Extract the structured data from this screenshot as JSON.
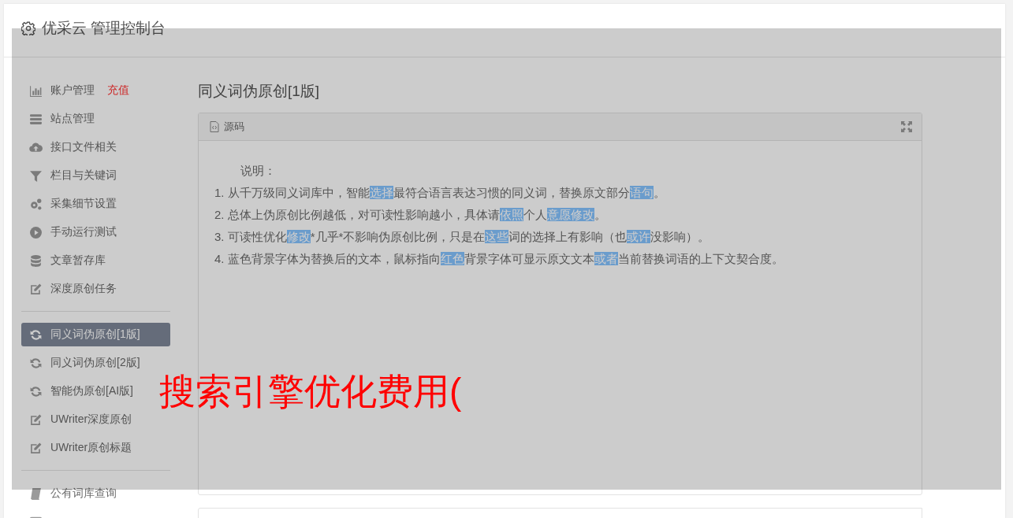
{
  "header": {
    "title": "优采云 管理控制台"
  },
  "sidebar": {
    "groups": [
      {
        "items": [
          {
            "kind": "chart",
            "label": "账户管理",
            "badge": "充值",
            "selected": false
          },
          {
            "kind": "server",
            "label": "站点管理",
            "selected": false
          },
          {
            "kind": "cloud",
            "label": "接口文件相关",
            "selected": false
          },
          {
            "kind": "filter",
            "label": "栏目与关键词",
            "selected": false
          },
          {
            "kind": "gears",
            "label": "采集细节设置",
            "selected": false
          },
          {
            "kind": "play",
            "label": "手动运行测试",
            "selected": false
          },
          {
            "kind": "database",
            "label": "文章暂存库",
            "selected": false
          },
          {
            "kind": "edit",
            "label": "深度原创任务",
            "selected": false
          }
        ]
      },
      {
        "items": [
          {
            "kind": "refresh",
            "label": "同义词伪原创[1版]",
            "selected": true
          },
          {
            "kind": "refresh",
            "label": "同义词伪原创[2版]",
            "selected": false
          },
          {
            "kind": "refresh",
            "label": "智能伪原创[AI版]",
            "selected": false
          },
          {
            "kind": "edit",
            "label": "UWriter深度原创",
            "selected": false
          },
          {
            "kind": "edit",
            "label": "UWriter原创标题",
            "selected": false
          }
        ]
      },
      {
        "items": [
          {
            "kind": "book",
            "label": "公有词库查询",
            "selected": false
          },
          {
            "kind": "square",
            "selected": false
          }
        ]
      }
    ]
  },
  "main": {
    "title": "同义词伪原创[1版]",
    "panel": {
      "tab": "源码",
      "intro": "说明：",
      "lines": [
        [
          {
            "text": "1. 从千万级同义词库中，智能",
            "highlight": false
          },
          {
            "text": "选择",
            "highlight": true
          },
          {
            "text": "最符合语言表达习惯的同义词，替换原文部分",
            "highlight": false
          },
          {
            "text": "语句",
            "highlight": true
          },
          {
            "text": "。",
            "highlight": false
          }
        ],
        [
          {
            "text": "2. 总体上伪原创比例越低，对可读性影响越小，具体请",
            "highlight": false
          },
          {
            "text": "依照",
            "highlight": true
          },
          {
            "text": "个人",
            "highlight": false
          },
          {
            "text": "意愿",
            "highlight": true
          },
          {
            "text": "修改",
            "highlight": true
          },
          {
            "text": "。",
            "highlight": false
          }
        ],
        [
          {
            "text": "3. 可读性优化",
            "highlight": false
          },
          {
            "text": "修改",
            "highlight": true
          },
          {
            "text": "*几乎*不影响伪原创比例，只是在",
            "highlight": false
          },
          {
            "text": "这些",
            "highlight": true
          },
          {
            "text": "词的选择上有影响（也",
            "highlight": false
          },
          {
            "text": "或许",
            "highlight": true
          },
          {
            "text": "没影响）。",
            "highlight": false
          }
        ],
        [
          {
            "text": "4. 蓝色背景字体为替换后的文本，鼠标指向",
            "highlight": false
          },
          {
            "text": "红色",
            "highlight": true
          },
          {
            "text": "背景字体可显示原文文本",
            "highlight": false
          },
          {
            "text": "或者",
            "highlight": true
          },
          {
            "text": "当前替换词语的上下文契合度。",
            "highlight": false
          }
        ]
      ]
    }
  },
  "overlay_caption": "搜索引擎优化费用("
}
